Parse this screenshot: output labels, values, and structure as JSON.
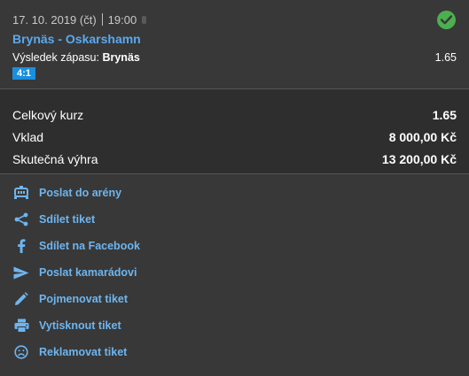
{
  "bet": {
    "date": "17. 10. 2019 (čt)",
    "time": "19:00",
    "match": "Brynäs - Oskarshamn",
    "result_label": "Výsledek zápasu:",
    "result_pick": "Brynäs",
    "odd": "1.65",
    "score": "4:1",
    "status_icon": "check-circle-icon",
    "status_color": "#4caf50"
  },
  "totals": {
    "total_odds_label": "Celkový kurz",
    "total_odds_value": "1.65",
    "stake_label": "Vklad",
    "stake_value": "8 000,00 Kč",
    "win_label": "Skutečná výhra",
    "win_value": "13 200,00 Kč"
  },
  "actions": [
    {
      "label": "Poslat do arény",
      "icon": "arena-icon"
    },
    {
      "label": "Sdílet tiket",
      "icon": "share-icon"
    },
    {
      "label": "Sdílet na Facebook",
      "icon": "facebook-icon"
    },
    {
      "label": "Poslat kamarádovi",
      "icon": "send-icon"
    },
    {
      "label": "Pojmenovat tiket",
      "icon": "pencil-icon"
    },
    {
      "label": "Vytisknout tiket",
      "icon": "printer-icon"
    },
    {
      "label": "Reklamovat tiket",
      "icon": "sad-face-icon"
    }
  ],
  "colors": {
    "link": "#6eb5ef",
    "match": "#5aa9f0",
    "score_badge": "#1a8fe0",
    "background": "#383838",
    "totals_background": "#2e2e2e"
  }
}
